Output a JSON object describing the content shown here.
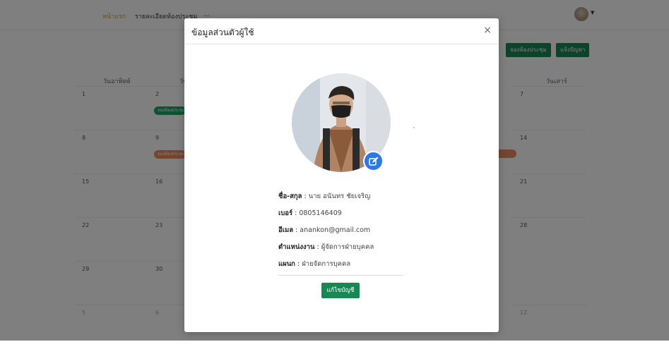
{
  "nav": {
    "home": "หน้าแรก",
    "room_details": "รายละเอียดห้องประชุม",
    "third": "..."
  },
  "actions": {
    "book_room": "จองห้องประชุม",
    "report_issue": "แจ้งปัญหา"
  },
  "calendar": {
    "weekdays": [
      "วันอาทิตย์",
      "วัน...",
      "",
      "",
      "",
      "",
      "วันเสาร์"
    ],
    "days": [
      "1",
      "2",
      "7",
      "8",
      "9",
      "14",
      "15",
      "16",
      "21",
      "22",
      "23",
      "28",
      "29",
      "30",
      "5",
      "6",
      "12"
    ],
    "events": [
      "จองห้องประชุม",
      "จองห้องประชุม"
    ]
  },
  "modal": {
    "title": "ข้อมูลส่วนตัวผู้ใช้",
    "close": "×",
    "fields": [
      {
        "label": "ชื่อ-สกุล",
        "value": "นาย อนันทร ชัยเจริญ"
      },
      {
        "label": "เบอร์",
        "value": "0805146409"
      },
      {
        "label": "อีเมล",
        "value": "anankon@gmail.com"
      },
      {
        "label": "ตำแหน่งงาน",
        "value": "ผู้จัดการฝ่ายบุคคล"
      },
      {
        "label": "แผนก",
        "value": "ฝ่ายจัดการบุคคล"
      }
    ],
    "separator": " : ",
    "edit_button": "แก้ไขบัญชี"
  },
  "icons": {
    "edit_photo": "edit-icon",
    "user_menu": "chevron-down-icon"
  },
  "colors": {
    "primary_green": "#198754",
    "edit_blue": "#2979e8",
    "event_green": "#1aa564",
    "event_orange": "#e88a62"
  }
}
